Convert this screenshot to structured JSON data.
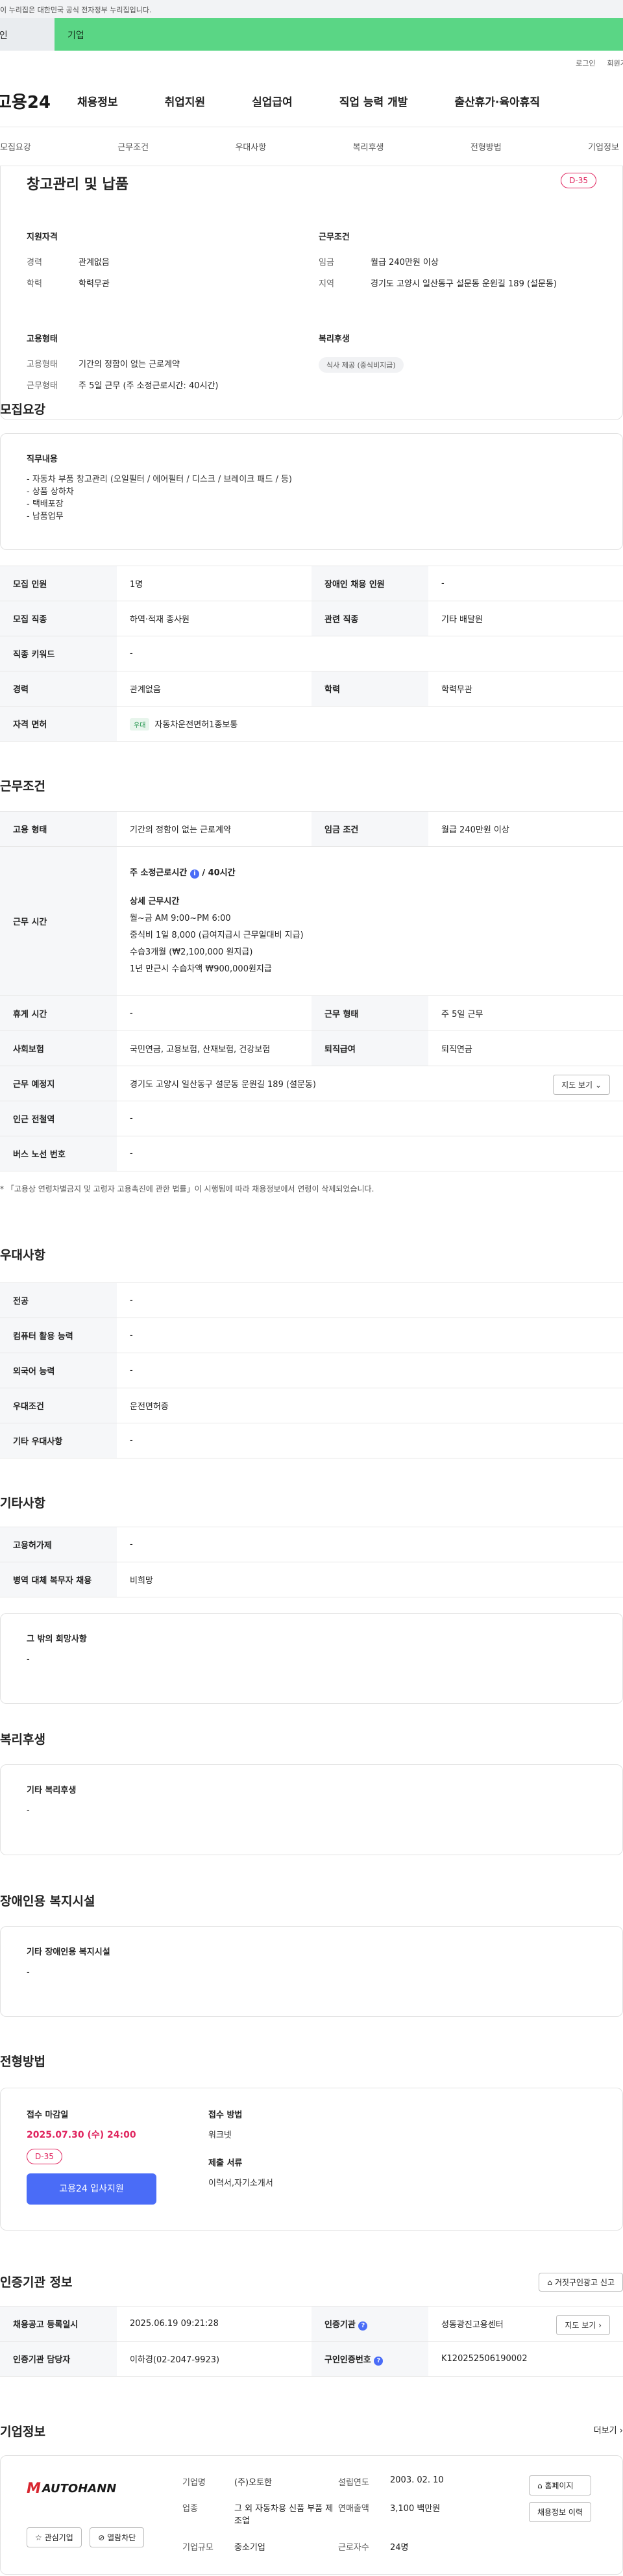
{
  "banner": {
    "text": "이 누리집은 대한민국 공식 전자정부 누리집입니다."
  },
  "top_tabs": {
    "personal": "개인",
    "company": "기업"
  },
  "util": {
    "login": "로그인",
    "signup": "회원가입"
  },
  "gnb": {
    "logo": "고용24",
    "menu": [
      "채용정보",
      "취업지원",
      "실업급여",
      "직업 능력 개발",
      "출산휴가·육아휴직"
    ]
  },
  "subtabs": [
    "모집요강",
    "근무조건",
    "우대사항",
    "복리후생",
    "전형방법",
    "기업정보"
  ],
  "title": {
    "job_title": "창고관리 및 납품",
    "dday": "D-35"
  },
  "summary": {
    "qual_h": "지원자격",
    "career_k": "경력",
    "career_v": "관계없음",
    "edu_k": "학력",
    "edu_v": "학력무관",
    "cond_h": "근무조건",
    "wage_k": "임금",
    "wage_v": "월급 240만원 이상",
    "region_k": "지역",
    "region_v": "경기도 고양시 일산동구 설문동 운원길 189 (설문동)",
    "emp_h": "고용형태",
    "emptype_k": "고용형태",
    "emptype_v": "기간의 정함이 없는 근로계약",
    "worktype_k": "근무형태",
    "worktype_v": "주 5일 근무 (주 소정근로시간: 40시간)",
    "welfare_h": "복리후생",
    "welfare_tag": "식사 제공 (중식비지급)"
  },
  "recruit": {
    "section_title": "모집요강",
    "duty_h": "직무내용",
    "duty_text": "- 자동차 부품 창고관리 (오일필터 / 에어필터 / 디스크 / 브레이크 패드 / 등)\n- 상품 상하차\n- 택배포장\n- 납품업무",
    "rows": {
      "headcount_k": "모집 인원",
      "headcount_v": "1명",
      "disabled_k": "장애인 채용 인원",
      "disabled_v": "-",
      "job_k": "모집 직종",
      "job_v": "하역·적재 종사원",
      "related_k": "관련 직종",
      "related_v": "기타 배달원",
      "keyword_k": "직종 키워드",
      "keyword_v": "-",
      "career_k": "경력",
      "career_v": "관계없음",
      "edu_k": "학력",
      "edu_v": "학력무관",
      "license_k": "자격 면허",
      "license_tag": "우대",
      "license_v": "자동차운전면허1종보통"
    }
  },
  "conditions": {
    "section_title": "근무조건",
    "emptype_k": "고용 형태",
    "emptype_v": "기간의 정함이 없는 근로계약",
    "wage_k": "임금 조건",
    "wage_v": "월급 240만원 이상",
    "hours_k": "근무 시간",
    "hours_line1": "주 소정근로시간",
    "hours_line1_v": "/ 40시간",
    "hours_detail_h": "상세 근무시간",
    "hours_detail": "월~금 AM 9:00~PM 6:00\n중식비 1일 8,000 (급여지급시 근무일대비 지급)\n수습3개월 (₩2,100,000 원지급)\n1년 만근시 수습차액 ₩900,000원지급",
    "holiday_k": "휴게 시간",
    "holiday_v": "-",
    "worktype_k": "근무 형태",
    "worktype_v": "주 5일 근무",
    "insurance_k": "사회보험",
    "insurance_v": "국민연금, 고용보험, 산재보험, 건강보험",
    "retire_k": "퇴직급여",
    "retire_v": "퇴직연금",
    "place_k": "근무 예정지",
    "place_v": "경기도 고양시 일산동구 설문동 운원길 189 (설문동)",
    "map_btn": "지도 보기",
    "subway_k": "인근 전철역",
    "subway_v": "-",
    "bus_k": "버스 노선 번호",
    "bus_v": "-",
    "note": "* 「고용상 연령차별금지 및 고령자 고용촉진에 관한 법률」이 시행됨에 따라 채용정보에서 연령이 삭제되었습니다."
  },
  "preference": {
    "section_title": "우대사항",
    "major_k": "전공",
    "major_v": "-",
    "computer_k": "컴퓨터 활용 능력",
    "computer_v": "-",
    "lang_k": "외국어 능력",
    "lang_v": "-",
    "pref_k": "우대조건",
    "pref_v": "운전면허증",
    "etc_k": "기타 우대사항",
    "etc_v": "-"
  },
  "etc": {
    "section_title": "기타사항",
    "memo_k": "고용허가제",
    "memo_v": "-",
    "military_k": "병역 대체 복무자 채용",
    "military_v": "비희망",
    "other_h": "그 밖의 희망사항",
    "other_v": "-"
  },
  "welfare": {
    "section_title": "복리후생",
    "h": "기타 복리후생",
    "v": "-"
  },
  "disabled_facility": {
    "section_title": "장애인용 복지시설",
    "h": "기타 장애인용 복지시설",
    "v": "-"
  },
  "apply": {
    "section_title": "전형방법",
    "deadline_h": "접수 마감일",
    "deadline_v": "2025.07.30 (수) 24:00",
    "dday": "D-35",
    "apply_btn": "고용24 입사지원",
    "method_h": "접수 방법",
    "method_v": "워크넷",
    "docs_h": "제출 서류",
    "docs_v": "이력서,자기소개서"
  },
  "cert": {
    "section_title": "인증기관 정보",
    "report_btn": "거짓구인광고 신고",
    "reg_k": "채용공고 등록일시",
    "reg_v": "2025.06.19 09:21:28",
    "org_k": "인증기관",
    "org_v": "성동광진고용센터",
    "map_btn": "지도 보기",
    "mgr_k": "인증기관 담당자",
    "mgr_v": "이하경(02-2047-9923)",
    "num_k": "구인인증번호",
    "num_v": "K120252506190002"
  },
  "company": {
    "section_title": "기업정보",
    "more": "더보기",
    "logo_text": "AUTOHANN",
    "name_k": "기업명",
    "name_v": "(주)오토한",
    "industry_k": "업종",
    "industry_v": "그 외 자동차용 신품 부품 제조업",
    "size_k": "기업규모",
    "size_v": "중소기업",
    "founded_k": "설립연도",
    "founded_v": "2003. 02. 10",
    "sales_k": "연매출액",
    "sales_v": "3,100 백만원",
    "employees_k": "근로자수",
    "employees_v": "24명",
    "homepage_btn": "홈페이지",
    "history_btn": "채용정보 이력",
    "fav_btn": "관심기업",
    "block_btn": "열람차단"
  }
}
